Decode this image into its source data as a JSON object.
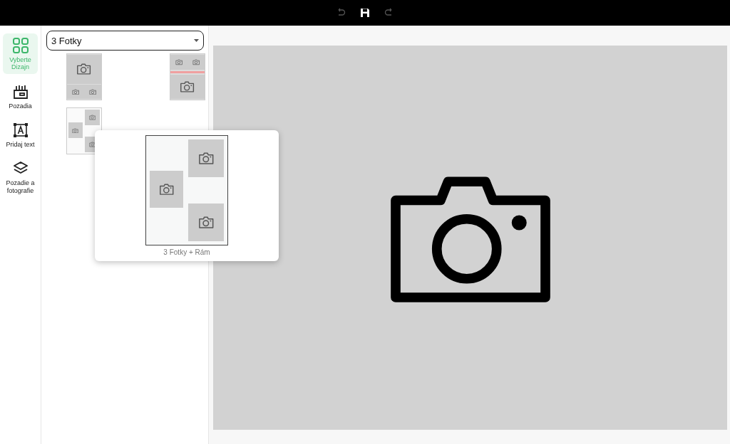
{
  "toolbar": [
    {
      "kind": "undo",
      "disabled": true
    },
    {
      "kind": "save",
      "disabled": false
    },
    {
      "kind": "redo",
      "disabled": true
    }
  ],
  "sidebar": {
    "items": [
      {
        "kind": "design",
        "label": "Vyberte Dizajn",
        "selected": true
      },
      {
        "kind": "backgrounds",
        "label": "Pozadia",
        "selected": false
      },
      {
        "kind": "text",
        "label": "Pridaj text",
        "selected": false
      },
      {
        "kind": "layers",
        "label": "Pozadie a fotografie",
        "selected": false
      }
    ]
  },
  "panel": {
    "dropdown": {
      "value": "3 Fotky"
    },
    "layouts": [
      {
        "kind": "big-top"
      },
      {
        "kind": "big-bottom-strip"
      },
      {
        "kind": "frame"
      }
    ]
  },
  "tooltip": {
    "kind": "frame",
    "label": "3 Fotky + Rám"
  }
}
